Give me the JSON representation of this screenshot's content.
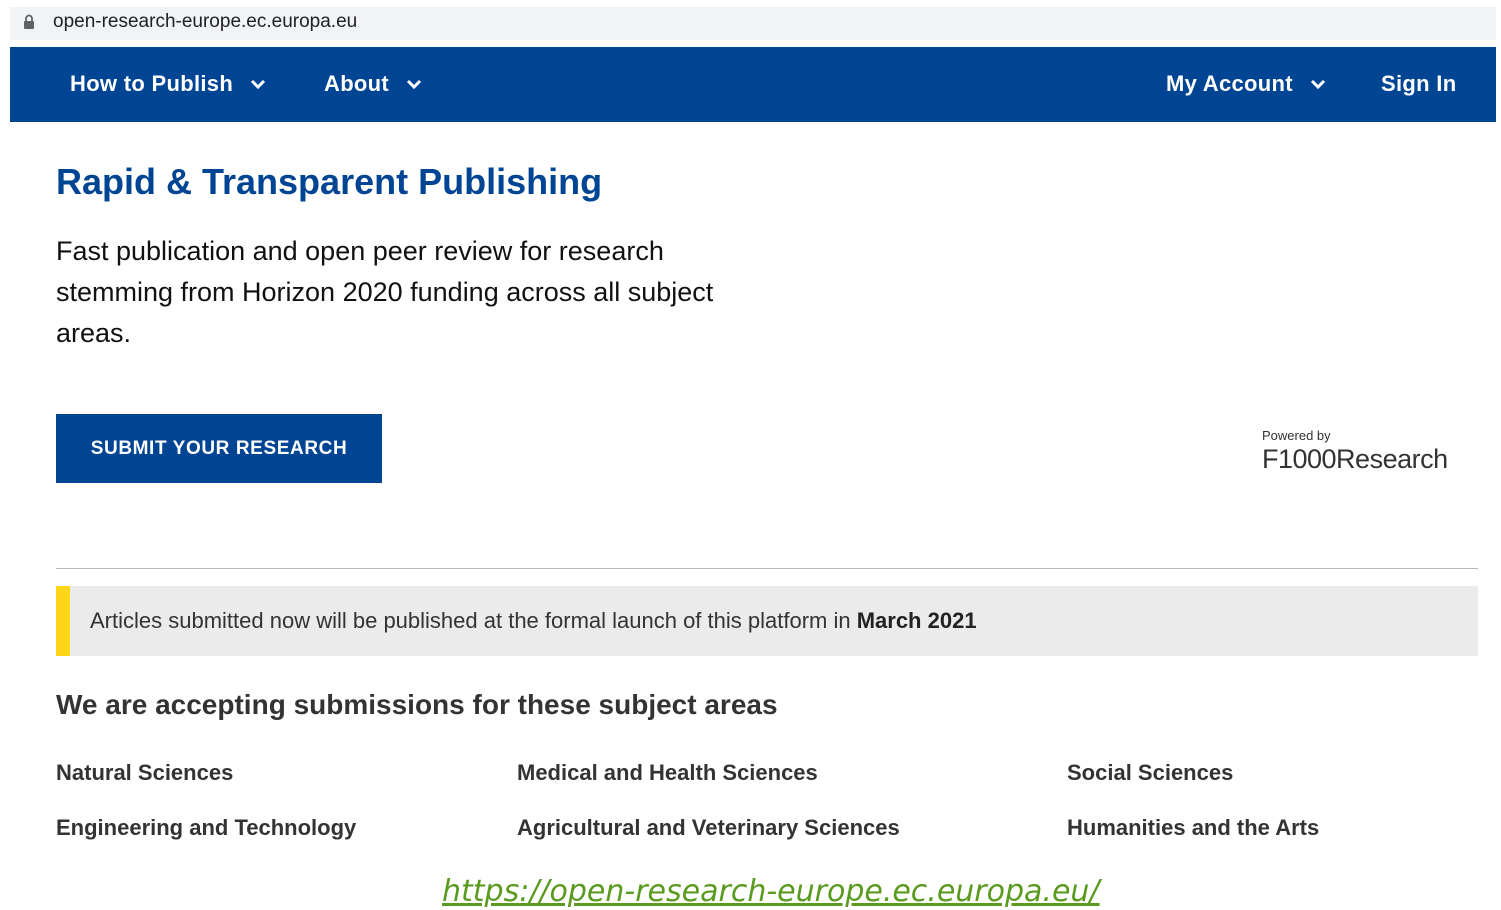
{
  "browser": {
    "url": "open-research-europe.ec.europa.eu"
  },
  "nav": {
    "how_to_publish": "How to Publish",
    "about": "About",
    "my_account": "My Account",
    "sign_in": "Sign In"
  },
  "hero": {
    "title": "Rapid & Transparent Publishing",
    "description": "Fast publication and open peer review for research stemming from Horizon 2020 funding across all subject areas.",
    "submit_label": "SUBMIT YOUR RESEARCH",
    "powered_by": "Powered by",
    "logo_text": "F1000Research"
  },
  "notice": {
    "text": "Articles submitted now will be published at the formal launch of this platform in ",
    "highlight": "March 2021"
  },
  "subjects": {
    "heading": "We are accepting submissions for these subject areas",
    "items": [
      "Natural Sciences",
      "Medical and Health Sciences",
      "Social Sciences",
      "Engineering and Technology",
      "Agricultural and Veterinary Sciences",
      "Humanities and the Arts"
    ]
  },
  "footer": {
    "url": "https://open-research-europe.ec.europa.eu/"
  },
  "colors": {
    "brand_blue": "#004494",
    "notice_accent": "#ffd617",
    "footer_link": "#5a9a1e"
  },
  "icons": {
    "lock": "lock-icon",
    "dropdown": "chevron-down-icon"
  }
}
